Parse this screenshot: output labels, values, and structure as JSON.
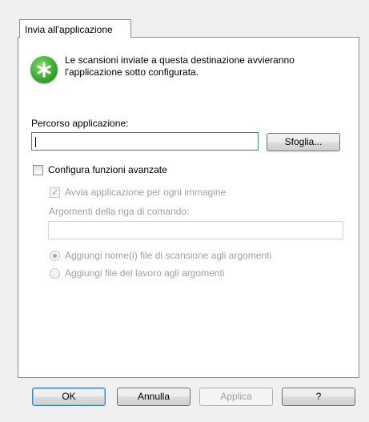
{
  "tab": {
    "label": "Invia all'applicazione"
  },
  "description": {
    "line1": "Le scansioni inviate a questa destinazione avvieranno",
    "line2": "l'applicazione sotto configurata."
  },
  "path": {
    "label": "Percorso applicazione:",
    "value": "",
    "browse_label": "Sfoglia..."
  },
  "advanced": {
    "checkbox_label": "Configura funzioni avanzate",
    "checked": false,
    "launch_per_image_label": "Avvia applicazione per ogni immagine",
    "launch_per_image_checked": true,
    "args_label": "Argomenti della riga di comando:",
    "args_value": "",
    "radio_add_filenames_label": "Aggiungi nome(i) file di scansione agli argomenti",
    "radio_add_job_file_label": "Aggiungi file del lavoro agli argomenti",
    "selected_option": "Aggiungi nome(i) file di scansione agli argomenti"
  },
  "buttons": {
    "ok": "OK",
    "cancel": "Annulla",
    "apply": "Applica",
    "help": "?"
  },
  "icons": {
    "info": "green-asterisk-icon"
  },
  "colors": {
    "icon_green": "#3caa2f",
    "focus_border": "#3c7fb1",
    "disabled_text": "#a0a0a0"
  }
}
